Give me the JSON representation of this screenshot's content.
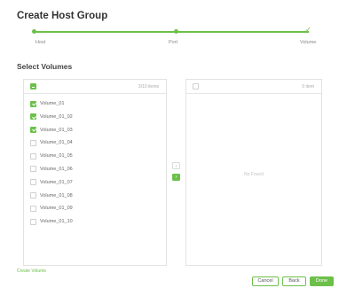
{
  "dialog": {
    "title": "Create Host Group"
  },
  "steps": [
    {
      "label": "Host"
    },
    {
      "label": "Port"
    },
    {
      "label": "Volume"
    }
  ],
  "select_volumes": {
    "title": "Select Volumes",
    "left_panel": {
      "count": "3/10 items",
      "items": [
        {
          "name": "Volume_01",
          "checked": true
        },
        {
          "name": "Volume_01_02",
          "checked": true
        },
        {
          "name": "Volume_01_03",
          "checked": true
        },
        {
          "name": "Volume_01_04",
          "checked": false
        },
        {
          "name": "Volume_01_05",
          "checked": false
        },
        {
          "name": "Volume_01_06",
          "checked": false
        },
        {
          "name": "Volume_01_07",
          "checked": false
        },
        {
          "name": "Volume_01_08",
          "checked": false
        },
        {
          "name": "Volume_01_09",
          "checked": false
        },
        {
          "name": "Volume_01_10",
          "checked": false
        }
      ]
    },
    "right_panel": {
      "count": "0 item",
      "empty_text": "No Found"
    },
    "transfer": {
      "left_glyph": "‹",
      "right_glyph": "›"
    }
  },
  "create_volume_link": "Create Volume",
  "footer": {
    "cancel": "Cancel",
    "back": "Back",
    "done": "Done"
  },
  "colors": {
    "accent": "#6cc04a",
    "border": "#e2e2e2",
    "text": "#333333"
  }
}
